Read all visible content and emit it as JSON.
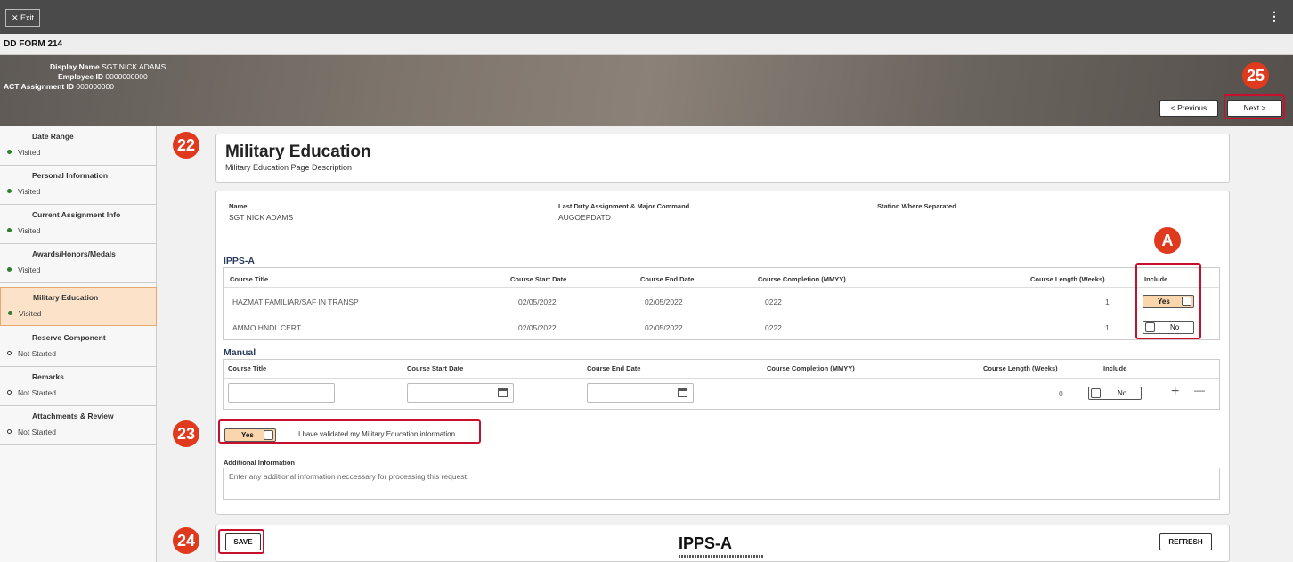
{
  "topbar": {
    "exit_label": "✕ Exit",
    "menu_icon": "⋮"
  },
  "form_title": "DD FORM 214",
  "header": {
    "display_name_label": "Display Name",
    "display_name": "SGT NICK ADAMS",
    "employee_id_label": "Employee ID",
    "employee_id": "0000000000",
    "act_assignment_label": "ACT Assignment ID",
    "act_assignment_id": "000000000"
  },
  "nav": {
    "previous": "< Previous",
    "next": "Next >"
  },
  "sidebar": {
    "items": [
      {
        "label": "Date Range",
        "status": "Visited"
      },
      {
        "label": "Personal Information",
        "status": "Visited"
      },
      {
        "label": "Current Assignment Info",
        "status": "Visited"
      },
      {
        "label": "Awards/Honors/Medals",
        "status": "Visited"
      },
      {
        "label": "Military Education",
        "status": "Visited"
      },
      {
        "label": "Reserve Component",
        "status": "Not Started"
      },
      {
        "label": "Remarks",
        "status": "Not Started"
      },
      {
        "label": "Attachments & Review",
        "status": "Not Started"
      }
    ]
  },
  "page": {
    "title": "Military Education",
    "description": "Military Education Page Description"
  },
  "info": {
    "name_label": "Name",
    "name": "SGT NICK ADAMS",
    "last_duty_label": "Last Duty Assignment & Major Command",
    "last_duty": "AUGOEPDATD",
    "station_label": "Station Where Separated"
  },
  "ipps": {
    "heading": "IPPS-A",
    "columns": [
      "Course Title",
      "Course Start Date",
      "Course End Date",
      "Course Completion (MMYY)",
      "Course Length (Weeks)",
      "Include"
    ],
    "rows": [
      {
        "title": "HAZMAT FAMILIAR/SAF IN TRANSP",
        "start": "02/05/2022",
        "end": "02/05/2022",
        "completion": "0222",
        "length": "1",
        "include": "Yes"
      },
      {
        "title": "AMMO HNDL CERT",
        "start": "02/05/2022",
        "end": "02/05/2022",
        "completion": "0222",
        "length": "1",
        "include": "No"
      }
    ]
  },
  "manual": {
    "heading": "Manual",
    "columns": [
      "Course Title",
      "Course Start Date",
      "Course End Date",
      "Course Completion (MMYY)",
      "Course Length (Weeks)",
      "Include"
    ],
    "row": {
      "length": "0",
      "include": "No"
    },
    "plus": "+",
    "minus": "—"
  },
  "validation": {
    "toggle": "Yes",
    "text": "I have validated my Military Education information"
  },
  "additional": {
    "label": "Additional Information",
    "placeholder": "Enter any additional information neccessary for processing this request."
  },
  "footer": {
    "save": "SAVE",
    "refresh": "REFRESH",
    "logo": "IPPS-A"
  },
  "callouts": {
    "c22": "22",
    "c23": "23",
    "c24": "24",
    "c25": "25",
    "cA": "A"
  },
  "colors": {
    "accent": "#fbd6ad",
    "callout": "#e03a1e",
    "active_nav": "#fbe2c9"
  }
}
